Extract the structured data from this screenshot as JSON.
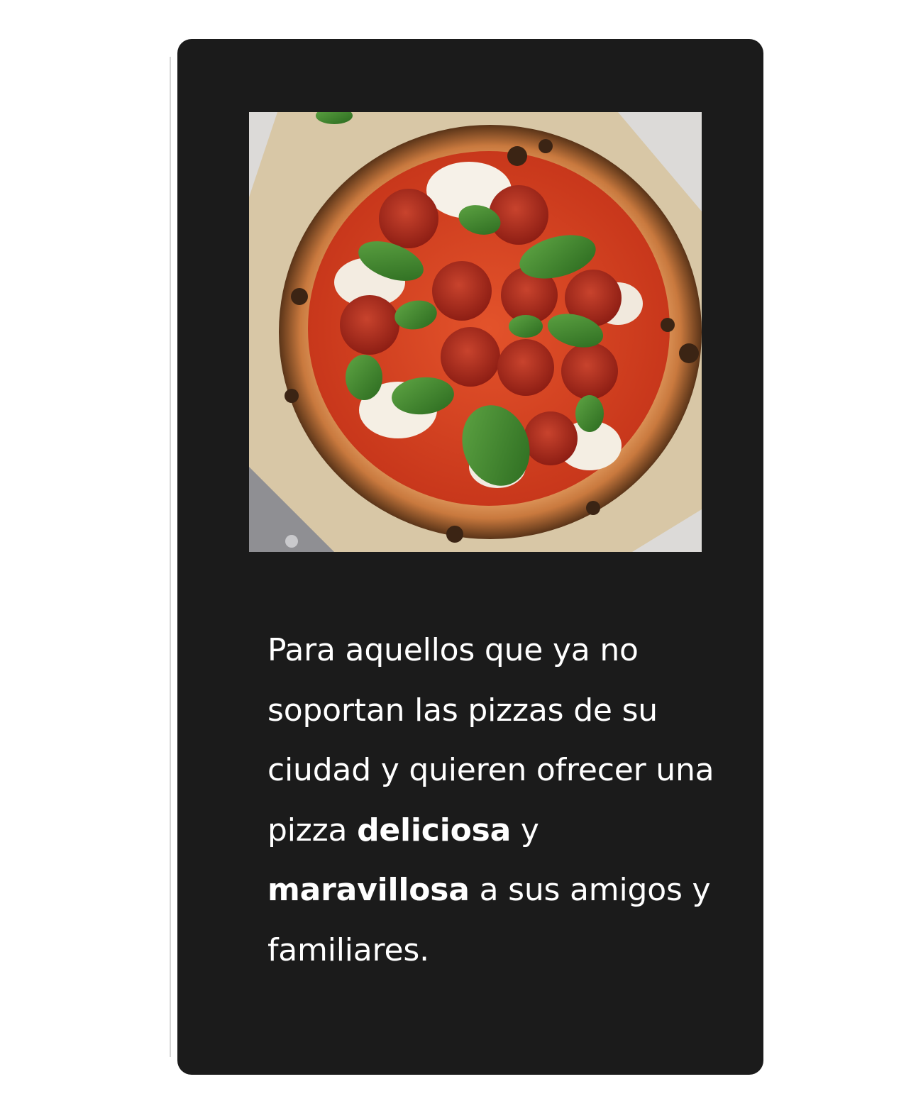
{
  "card": {
    "image_alt": "Pizza pepperoni con albahaca",
    "paragraph": {
      "part1": "Para aquellos que ya no soportan las pizzas de su ciudad y quieren ofrecer una pizza",
      "bold1": "deliciosa",
      "part2": "y",
      "bold2": "maravillosa",
      "part3": "a sus amigos y familiares."
    }
  },
  "colors": {
    "card_background": "#1b1b1b",
    "text": "#ffffff"
  }
}
